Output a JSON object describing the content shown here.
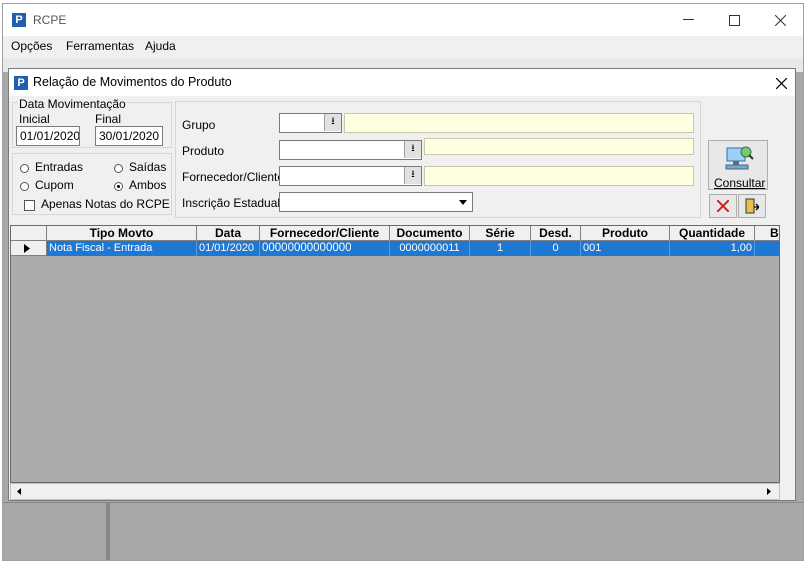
{
  "app": {
    "title": "RCPE",
    "logo_letter": "P"
  },
  "menu": [
    "Opções",
    "Ferramentas",
    "Ajuda"
  ],
  "dialog": {
    "title": "Relação de Movimentos do Produto"
  },
  "date_group": {
    "legend": "Data Movimentação",
    "initial_label": "Inicial",
    "final_label": "Final",
    "initial_value": "01/01/2020",
    "final_value": "30/01/2020"
  },
  "type_group": {
    "entradas": "Entradas",
    "saidas": "Saídas",
    "cupom": "Cupom",
    "ambos": "Ambos",
    "selected": "Ambos",
    "only_rcpe": "Apenas Notas do RCPE"
  },
  "filters": {
    "grupo": "Grupo",
    "produto": "Produto",
    "fornecedor": "Fornecedor/Cliente",
    "inscricao": "Inscrição Estadual"
  },
  "actions": {
    "consultar": "Consultar"
  },
  "grid": {
    "columns": [
      "Tipo Movto",
      "Data",
      "Fornecedor/Cliente",
      "Documento",
      "Série",
      "Desd.",
      "Produto",
      "Quantidade",
      "B"
    ],
    "rows": [
      [
        "Nota Fiscal - Entrada",
        "01/01/2020",
        "00000000000000",
        "0000000011",
        "1",
        "0",
        "001",
        "1,00",
        ""
      ]
    ]
  },
  "colors": {
    "selection": "#1e78d2",
    "yellow_field": "#ffffe1",
    "grid_bg": "#ababab"
  }
}
